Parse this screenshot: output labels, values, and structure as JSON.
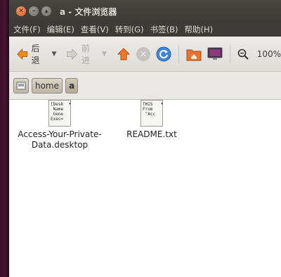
{
  "window": {
    "title": "a - 文件浏览器",
    "controls": [
      "close",
      "minimize",
      "maximize"
    ]
  },
  "menubar": {
    "items": [
      "文件(F)",
      "编辑(E)",
      "查看(V)",
      "转到(G)",
      "书签(B)",
      "帮助(H)"
    ]
  },
  "toolbar": {
    "back_label": "后退",
    "forward_label": "前进",
    "zoom_label": "100%",
    "icons": [
      "back-arrow-icon",
      "forward-arrow-icon",
      "up-arrow-icon",
      "stop-icon",
      "reload-icon",
      "home-folder-icon",
      "computer-icon",
      "zoom-out-icon"
    ]
  },
  "location": {
    "crumbs": [
      "home",
      "a"
    ],
    "drive_icon": "drive-icon"
  },
  "files": [
    {
      "name_line1": "Access-Your-Private-",
      "name_line2": "Data.desktop",
      "preview": [
        "[Desk",
        " Name",
        " Gene",
        "Exec="
      ]
    },
    {
      "name_line1": "README.txt",
      "name_line2": "",
      "preview": [
        "THIS",
        "",
        "From",
        " \"Acc"
      ]
    }
  ],
  "colors": {
    "titlebar": "#3c3b37",
    "close_button": "#e1561e",
    "desktop": "#2c0f1f",
    "content_bg": "#ffffff"
  }
}
